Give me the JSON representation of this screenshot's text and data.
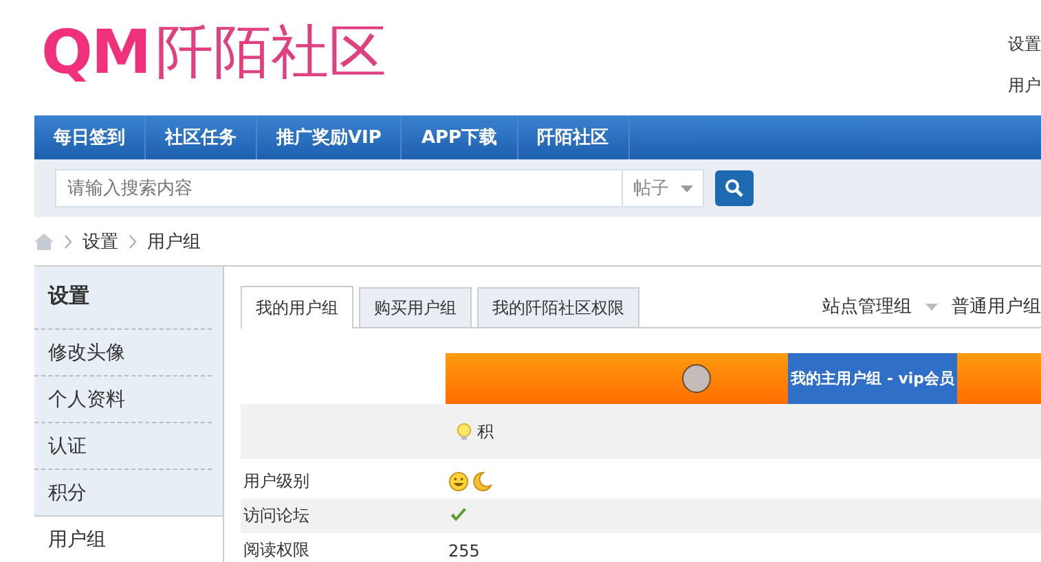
{
  "logo": {
    "mark": "QM",
    "name": "阡陌社区"
  },
  "top_links": [
    "设置",
    "用户"
  ],
  "nav": [
    {
      "label": "每日签到"
    },
    {
      "label": "社区任务"
    },
    {
      "label": "推广奖励VIP"
    },
    {
      "label": "APP下载"
    },
    {
      "label": "阡陌社区"
    }
  ],
  "search": {
    "placeholder": "请输入搜索内容",
    "scope": "帖子"
  },
  "breadcrumb": [
    "设置",
    "用户组"
  ],
  "sidebar": {
    "title": "设置",
    "items": [
      {
        "label": "修改头像",
        "selected": false
      },
      {
        "label": "个人资料",
        "selected": false
      },
      {
        "label": "认证",
        "selected": false
      },
      {
        "label": "积分",
        "selected": false
      },
      {
        "label": "用户组",
        "selected": true
      }
    ]
  },
  "tabs": [
    {
      "label": "我的用户组",
      "selected": true
    },
    {
      "label": "购买用户组",
      "selected": false
    },
    {
      "label": "我的阡陌社区权限",
      "selected": false
    }
  ],
  "group_switch": {
    "admin": "站点管理组",
    "normal": "普通用户组"
  },
  "banner": {
    "label": "我的主用户组 - vip会员"
  },
  "table": {
    "header": "积",
    "rows": [
      {
        "label": "用户级别",
        "kind": "icons"
      },
      {
        "label": "访问论坛",
        "kind": "check"
      },
      {
        "label": "阅读权限",
        "kind": "text",
        "value": "255"
      }
    ]
  }
}
